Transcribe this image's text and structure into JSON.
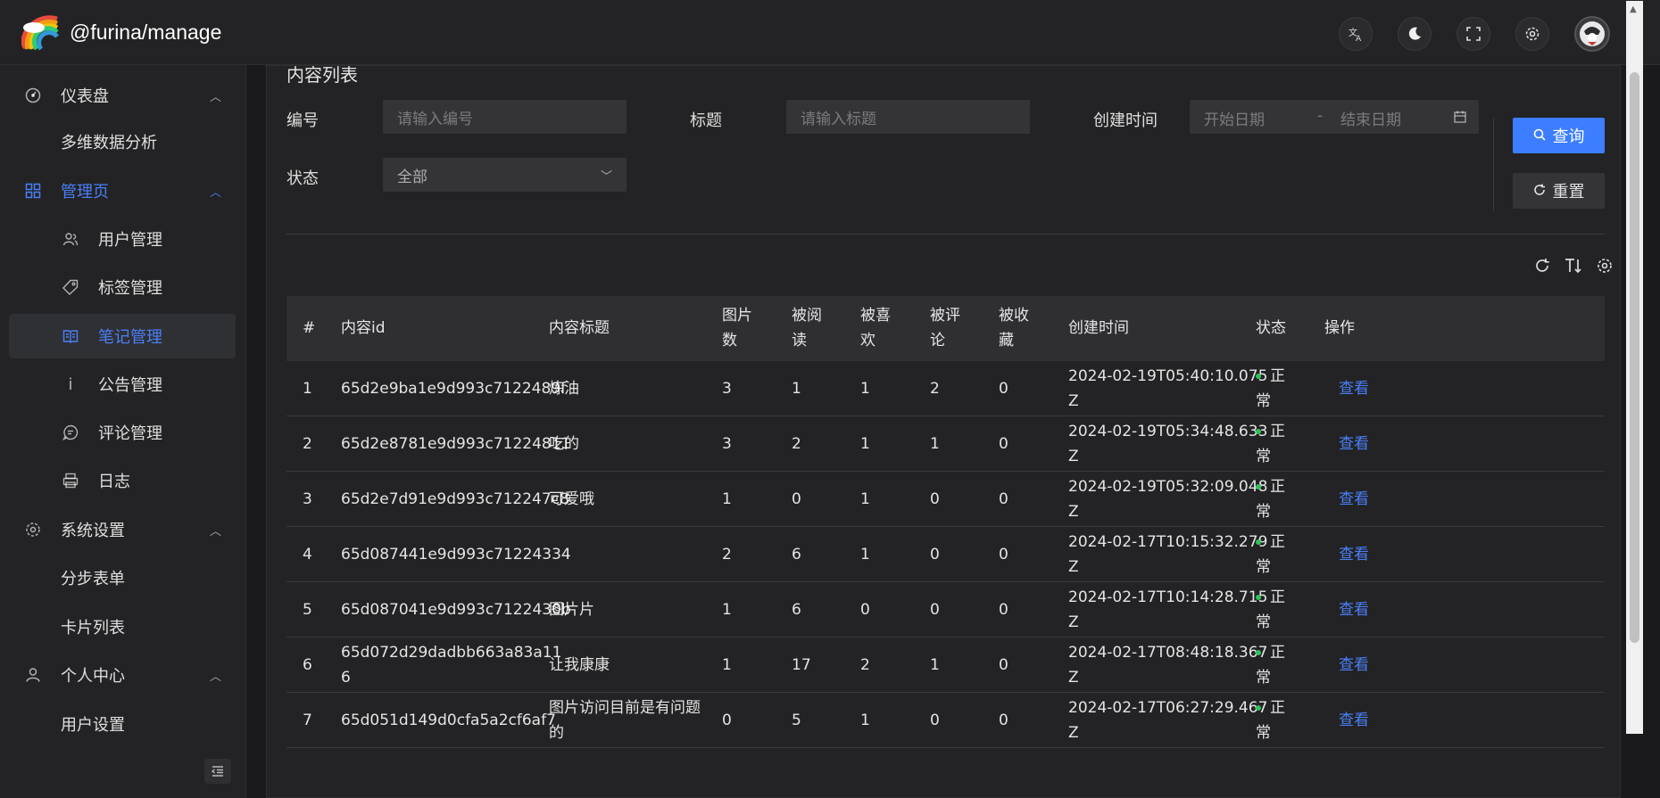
{
  "app": {
    "brand": "@furina/manage",
    "top_actions": [
      "translate-icon",
      "moon-icon",
      "fullscreen-icon",
      "gear-icon",
      "avatar"
    ]
  },
  "sidebar": {
    "items": [
      {
        "label": "仪表盘",
        "icon": "dashboard-icon",
        "type": "group"
      },
      {
        "label": "多维数据分析",
        "type": "leaf"
      },
      {
        "label": "管理页",
        "icon": "grid-icon",
        "type": "group-active"
      },
      {
        "label": "用户管理",
        "icon": "users-icon",
        "type": "sub"
      },
      {
        "label": "标签管理",
        "icon": "tag-icon",
        "type": "sub"
      },
      {
        "label": "笔记管理",
        "icon": "book-icon",
        "type": "sub-active"
      },
      {
        "label": "公告管理",
        "icon": "info-icon",
        "type": "sub"
      },
      {
        "label": "评论管理",
        "icon": "comment-icon",
        "type": "sub"
      },
      {
        "label": "日志",
        "icon": "printer-icon",
        "type": "sub"
      },
      {
        "label": "系统设置",
        "icon": "gear-icon",
        "type": "group"
      },
      {
        "label": "分步表单",
        "type": "leaf"
      },
      {
        "label": "卡片列表",
        "type": "leaf"
      },
      {
        "label": "个人中心",
        "icon": "user-icon",
        "type": "group"
      },
      {
        "label": "用户设置",
        "type": "leaf"
      }
    ]
  },
  "page": {
    "title": "内容列表",
    "filters": {
      "id_label": "编号",
      "id_placeholder": "请输入编号",
      "title_label": "标题",
      "title_placeholder": "请输入标题",
      "created_label": "创建时间",
      "start_placeholder": "开始日期",
      "range_sep": "-",
      "end_placeholder": "结束日期",
      "status_label": "状态",
      "status_value": "全部"
    },
    "search_label": "查询",
    "reset_label": "重置"
  },
  "table": {
    "columns": [
      "#",
      "内容id",
      "内容标题",
      "图片\n数",
      "被阅\n读",
      "被喜\n欢",
      "被评\n论",
      "被收\n藏",
      "创建时间",
      "状态",
      "操作"
    ],
    "rows": [
      {
        "no": "1",
        "id": "65d2e9ba1e9d993c7122489f",
        "title": "炼油",
        "images": "3",
        "reads": "1",
        "likes": "1",
        "comments": "2",
        "favs": "0",
        "created": "2024-02-19T05:40:10.075\nZ",
        "status": "正\n常",
        "action": "查看"
      },
      {
        "no": "2",
        "id": "65d2e8781e9d993c71224811",
        "title": "吃的",
        "images": "3",
        "reads": "2",
        "likes": "1",
        "comments": "1",
        "favs": "0",
        "created": "2024-02-19T05:34:48.633\nZ",
        "status": "正\n常",
        "action": "查看"
      },
      {
        "no": "3",
        "id": "65d2e7d91e9d993c712247c8",
        "title": "可爱哦",
        "images": "1",
        "reads": "0",
        "likes": "1",
        "comments": "0",
        "favs": "0",
        "created": "2024-02-19T05:32:09.048\nZ",
        "status": "正\n常",
        "action": "查看"
      },
      {
        "no": "4",
        "id": "65d087441e9d993c71224334",
        "title": "",
        "images": "2",
        "reads": "6",
        "likes": "1",
        "comments": "0",
        "favs": "0",
        "created": "2024-02-17T10:15:32.279\nZ",
        "status": "正\n常",
        "action": "查看"
      },
      {
        "no": "5",
        "id": "65d087041e9d993c7122430b",
        "title": "图片片",
        "images": "1",
        "reads": "6",
        "likes": "0",
        "comments": "0",
        "favs": "0",
        "created": "2024-02-17T10:14:28.715\nZ",
        "status": "正\n常",
        "action": "查看"
      },
      {
        "no": "6",
        "id": "65d072d29dadbb663a83a11\n6",
        "title": "让我康康",
        "images": "1",
        "reads": "17",
        "likes": "2",
        "comments": "1",
        "favs": "0",
        "created": "2024-02-17T08:48:18.367\nZ",
        "status": "正\n常",
        "action": "查看"
      },
      {
        "no": "7",
        "id": "65d051d149d0cfa5a2cf6af7",
        "title": "图片访问目前是有问题\n的",
        "images": "0",
        "reads": "5",
        "likes": "1",
        "comments": "0",
        "favs": "0",
        "created": "2024-02-17T06:27:29.467\nZ",
        "status": "正\n常",
        "action": "查看"
      }
    ]
  }
}
